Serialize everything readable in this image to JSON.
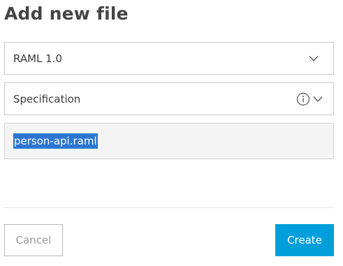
{
  "dialog": {
    "title": "Add new file"
  },
  "type_select": {
    "value": "RAML 1.0",
    "icon": "chevron-down-icon"
  },
  "kind_select": {
    "value": "Specification",
    "info_icon": "info-icon",
    "icon": "chevron-down-icon"
  },
  "filename": {
    "value": "person-api.raml",
    "selected": true
  },
  "actions": {
    "cancel_label": "Cancel",
    "create_label": "Create"
  },
  "colors": {
    "primary": "#009fdc",
    "selection": "#2b76d2"
  }
}
